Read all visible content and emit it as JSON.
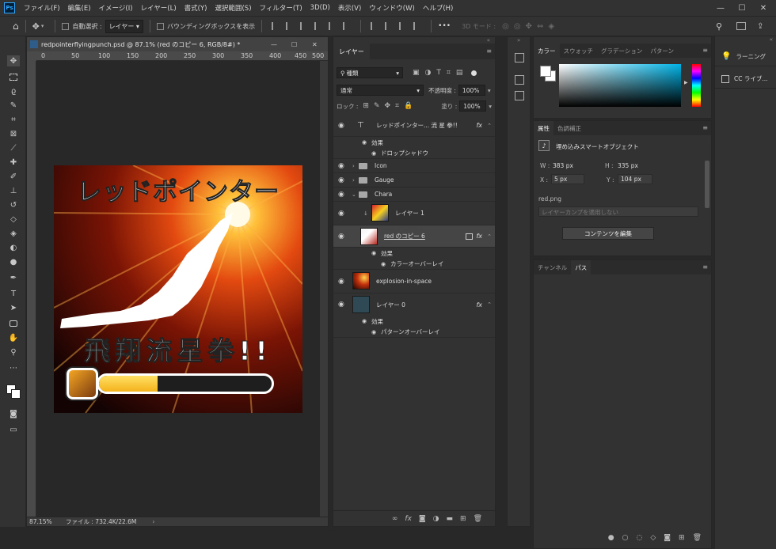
{
  "app": {
    "logo": "Ps"
  },
  "menu": [
    "ファイル(F)",
    "編集(E)",
    "イメージ(I)",
    "レイヤー(L)",
    "書式(Y)",
    "選択範囲(S)",
    "フィルター(T)",
    "3D(D)",
    "表示(V)",
    "ウィンドウ(W)",
    "ヘルプ(H)"
  ],
  "window_controls": {
    "minimize": "—",
    "maximize": "☐",
    "close": "✕"
  },
  "options": {
    "auto_select_label": "自動選択 :",
    "auto_select_target": "レイヤー",
    "bounding_box_label": "バウンディングボックスを表示",
    "more": "•••",
    "mode_3d_label": "3D モード :"
  },
  "document": {
    "tab_title": "redpointerflyingpunch.psd @ 87.1% (red のコピー 6, RGB/8#) *",
    "ruler_marks": [
      "0",
      "50",
      "100",
      "150",
      "200",
      "250",
      "300",
      "350",
      "400",
      "450",
      "500"
    ],
    "zoom": "87.15%",
    "file_info": "ファイル : 732.4K/22.6M",
    "artwork": {
      "title": "レッドポインター",
      "subtitle": "飛翔流星拳!!",
      "gauge_fill": 0.34
    }
  },
  "layers_panel": {
    "tab": "レイヤー",
    "filter_kind": "種類",
    "blend_mode": "通常",
    "opacity_label": "不透明度 :",
    "opacity_value": "100%",
    "lock_label": "ロック :",
    "fill_label": "塗り :",
    "fill_value": "100%",
    "layers": [
      {
        "name": "レッドポインター... 流 星 拳!!",
        "kind": "text",
        "fx": true
      },
      {
        "name": "効果",
        "kind": "effects-header"
      },
      {
        "name": "ドロップシャドウ",
        "kind": "effect"
      },
      {
        "name": "Icon",
        "kind": "group",
        "expanded": false
      },
      {
        "name": "Gauge",
        "kind": "group",
        "expanded": false
      },
      {
        "name": "Chara",
        "kind": "group",
        "expanded": true
      },
      {
        "name": "レイヤー 1",
        "kind": "clipped"
      },
      {
        "name": "red のコピー 6",
        "kind": "smart-object",
        "fx": true,
        "selected": true
      },
      {
        "name": "効果",
        "kind": "effects-header"
      },
      {
        "name": "カラーオーバーレイ",
        "kind": "effect"
      },
      {
        "name": "explosion-in-space",
        "kind": "image"
      },
      {
        "name": "レイヤー 0",
        "kind": "fill",
        "fx": true
      },
      {
        "name": "効果",
        "kind": "effects-header"
      },
      {
        "name": "パターンオーバーレイ",
        "kind": "effect"
      }
    ],
    "bottom_icons": [
      "link-icon",
      "fx-icon",
      "mask-icon",
      "adjustment-icon",
      "folder-icon",
      "new-layer-icon",
      "trash-icon"
    ]
  },
  "color_panel": {
    "tabs": [
      "カラー",
      "スウォッチ",
      "グラデーション",
      "パターン"
    ],
    "colors": {
      "spectrum_base": "#00b3e6"
    }
  },
  "properties_panel": {
    "tabs": [
      "属性",
      "色調補正"
    ],
    "type": "埋め込みスマートオブジェクト",
    "w_label": "W :",
    "w_value": "383 px",
    "h_label": "H :",
    "h_value": "335 px",
    "x_label": "X :",
    "x_value": "5 px",
    "y_label": "Y :",
    "y_value": "104 px",
    "file_name": "red.png",
    "layer_comp": "レイヤーカンプを適用しない",
    "edit_button": "コンテンツを編集"
  },
  "paths_panel": {
    "tabs": [
      "チャンネル",
      "パス"
    ]
  },
  "right_panel": {
    "items": [
      "ラーニング",
      "CC ライブ..."
    ]
  }
}
